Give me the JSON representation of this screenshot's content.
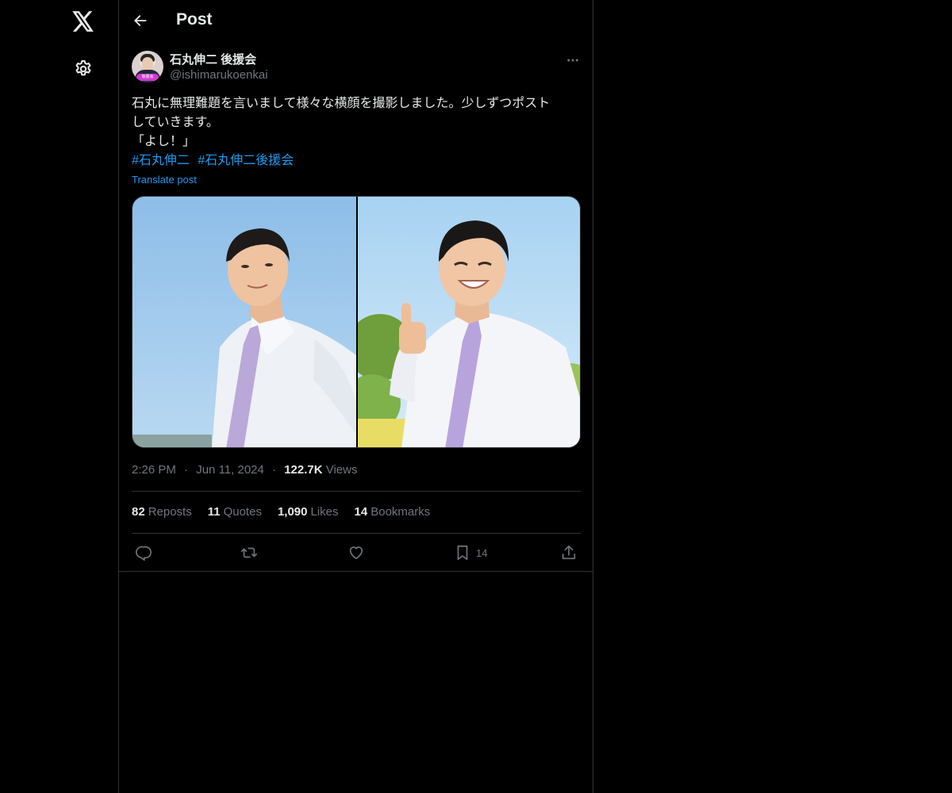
{
  "nav": {
    "logo_icon": "x-logo-icon",
    "settings_icon": "gear-icon"
  },
  "header": {
    "title": "Post",
    "back_icon": "arrow-left-icon"
  },
  "post": {
    "author": {
      "name": "石丸伸二 後援会",
      "handle": "@ishimarukoenkai",
      "avatar_badge": "後援会"
    },
    "text_lines": [
      "石丸に無理難題を言いまして様々な横顔を撮影しました。少しずつポスト",
      "していきます。",
      "「よし！」"
    ],
    "hashtags": [
      "#石丸伸二",
      "#石丸伸二後援会"
    ],
    "translate_label": "Translate post",
    "time": "2:26 PM",
    "date": "Jun 11, 2024",
    "views_count": "122.7K",
    "views_label": "Views",
    "stats": {
      "reposts": {
        "count": "82",
        "label": "Reposts"
      },
      "quotes": {
        "count": "11",
        "label": "Quotes"
      },
      "likes": {
        "count": "1,090",
        "label": "Likes"
      },
      "bookmarks": {
        "count": "14",
        "label": "Bookmarks"
      }
    },
    "actions": {
      "bookmark_count": "14"
    }
  },
  "colors": {
    "background": "#000000",
    "text": "#e7e9ea",
    "muted": "#71767b",
    "accent": "#1d9bf0",
    "border": "#2f3336"
  }
}
